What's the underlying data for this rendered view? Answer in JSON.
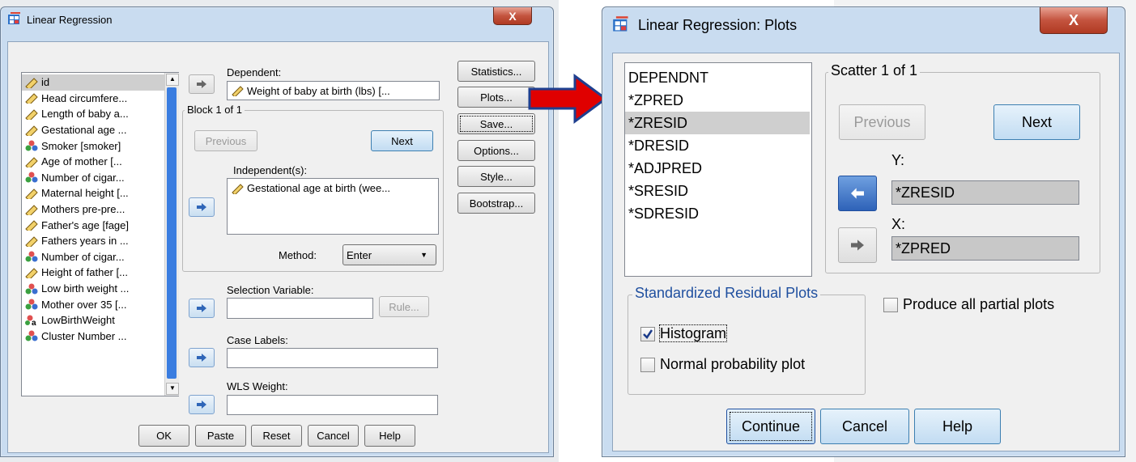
{
  "left_dialog": {
    "title": "Linear Regression",
    "close_label": "X",
    "variables": [
      {
        "label": "id",
        "icon": "scale-ruler-icon"
      },
      {
        "label": "Head circumfere...",
        "icon": "scale-ruler-icon"
      },
      {
        "label": "Length of baby a...",
        "icon": "scale-ruler-icon"
      },
      {
        "label": "Gestational age ...",
        "icon": "scale-ruler-icon"
      },
      {
        "label": "Smoker [smoker]",
        "icon": "nominal-icon"
      },
      {
        "label": "Age of mother [...",
        "icon": "scale-ruler-icon"
      },
      {
        "label": "Number of cigar...",
        "icon": "nominal-icon"
      },
      {
        "label": "Maternal height [...",
        "icon": "scale-ruler-icon"
      },
      {
        "label": "Mothers pre-pre...",
        "icon": "scale-ruler-icon"
      },
      {
        "label": "Father's age [fage]",
        "icon": "scale-ruler-icon"
      },
      {
        "label": "Fathers years in ...",
        "icon": "scale-ruler-icon"
      },
      {
        "label": "Number of cigar...",
        "icon": "nominal-icon"
      },
      {
        "label": "Height of father [...",
        "icon": "scale-ruler-icon"
      },
      {
        "label": "Low birth weight ...",
        "icon": "nominal-icon"
      },
      {
        "label": "Mother over 35 [...",
        "icon": "nominal-icon"
      },
      {
        "label": "LowBirthWeight",
        "icon": "nominal-string-icon"
      },
      {
        "label": "Cluster Number ...",
        "icon": "nominal-icon"
      }
    ],
    "dependent_label": "Dependent:",
    "dependent_value": "Weight of baby at birth (lbs) [...",
    "block_title": "Block 1 of 1",
    "previous_label": "Previous",
    "next_label": "Next",
    "independent_label": "Independent(s):",
    "independent_value": "Gestational age at birth (wee...",
    "method_label": "Method:",
    "method_value": "Enter",
    "selection_label": "Selection Variable:",
    "rule_label": "Rule...",
    "case_labels_label": "Case Labels:",
    "wls_label": "WLS Weight:",
    "side_buttons": [
      "Statistics...",
      "Plots...",
      "Save...",
      "Options...",
      "Style...",
      "Bootstrap..."
    ],
    "bottom_buttons": [
      "OK",
      "Paste",
      "Reset",
      "Cancel",
      "Help"
    ]
  },
  "right_dialog": {
    "title": "Linear Regression: Plots",
    "close_label": "X",
    "variables": [
      "DEPENDNT",
      "*ZPRED",
      "*ZRESID",
      "*DRESID",
      "*ADJPRED",
      "*SRESID",
      "*SDRESID"
    ],
    "scatter_title": "Scatter 1 of 1",
    "previous_label": "Previous",
    "next_label": "Next",
    "y_label": "Y:",
    "y_value": "*ZRESID",
    "x_label": "X:",
    "x_value": "*ZPRED",
    "std_group_title": "Standardized Residual Plots",
    "histogram_label": "Histogram",
    "histogram_checked": true,
    "normal_prob_label": "Normal probability plot",
    "normal_prob_checked": false,
    "partial_label": "Produce all partial plots",
    "partial_checked": false,
    "bottom_buttons": [
      "Continue",
      "Cancel",
      "Help"
    ]
  },
  "colors": {
    "arrow": "#e00000",
    "window_frame": "#c9dcf0",
    "close_button": "#c4543f",
    "selection": "#cfcfcf"
  }
}
